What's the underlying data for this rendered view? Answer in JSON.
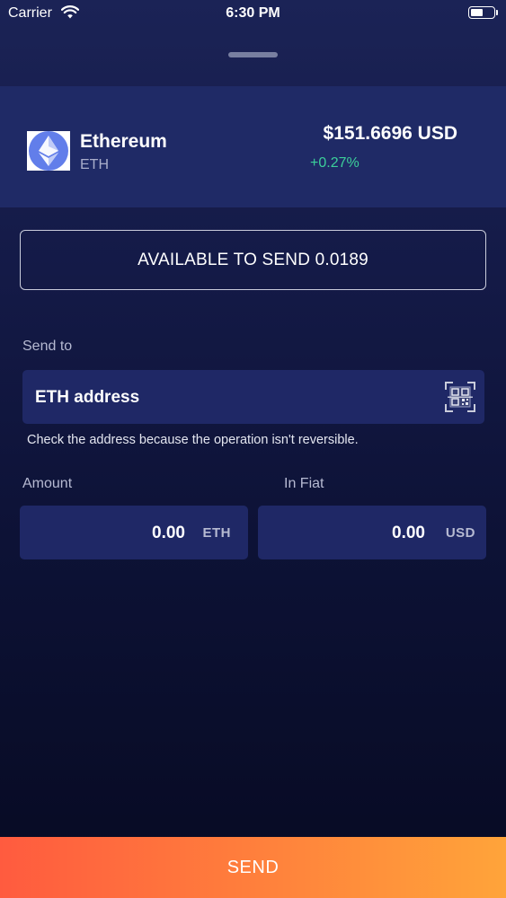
{
  "status_bar": {
    "carrier": "Carrier",
    "time": "6:30 PM",
    "battery_level": 0.55
  },
  "coin": {
    "name": "Ethereum",
    "symbol": "ETH",
    "price": "$151.6696 USD",
    "change": "+0.27%",
    "change_color": "#3ccf9a",
    "logo_color": "#627eea",
    "icon": "ethereum-logo-icon"
  },
  "available": {
    "text": "AVAILABLE TO SEND 0.0189"
  },
  "send_to": {
    "label": "Send to",
    "value": "ETH address",
    "qr_icon": "qr-scan-icon",
    "hint": "Check the address because the operation isn't reversible."
  },
  "amount": {
    "label": "Amount",
    "value": "0.00",
    "unit": "ETH"
  },
  "fiat": {
    "label": "In Fiat",
    "value": "0.00",
    "unit": "USD"
  },
  "send_button": {
    "label": "SEND"
  },
  "colors": {
    "accent_start": "#ff5b3f",
    "accent_end": "#ffa43a",
    "field_bg": "#1f2866",
    "header_bg": "#1f2a66"
  }
}
